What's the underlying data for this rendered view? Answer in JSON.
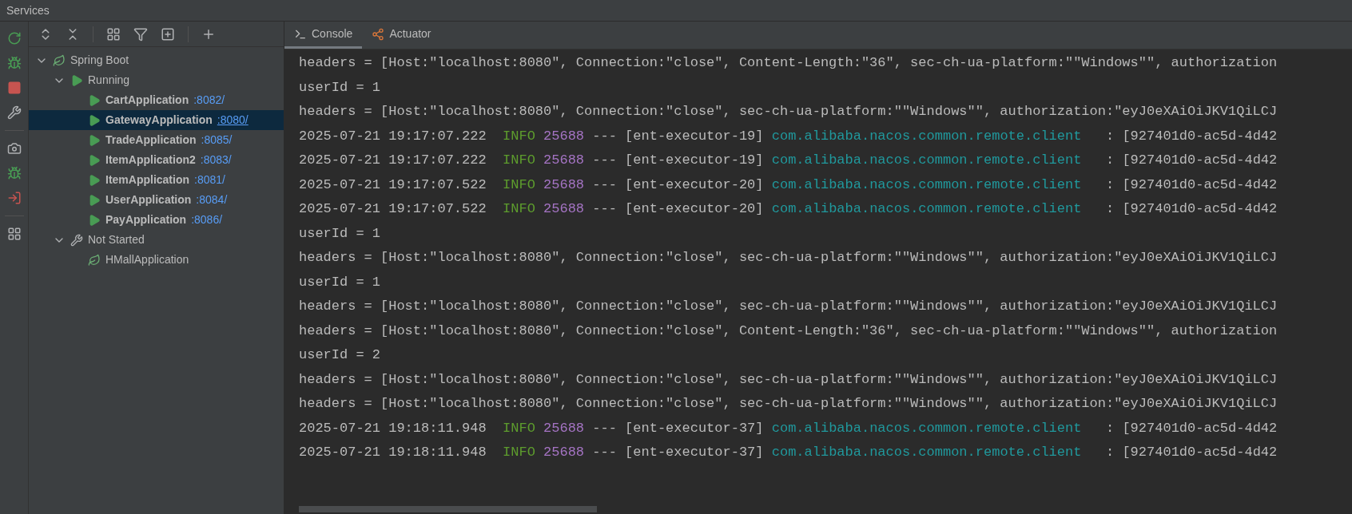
{
  "window": {
    "title": "Services"
  },
  "tree": [
    {
      "label": "Spring Boot",
      "kind": "spring",
      "expanded": true,
      "selected": false,
      "children": [
        {
          "label": "Running",
          "kind": "running",
          "expanded": true,
          "selected": false,
          "children": [
            {
              "label": "CartApplication",
              "port": ":8082/",
              "kind": "app-running",
              "selected": false
            },
            {
              "label": "GatewayApplication",
              "port": ":8080/",
              "kind": "app-running",
              "selected": true
            },
            {
              "label": "TradeApplication",
              "port": ":8085/",
              "kind": "app-running",
              "selected": false
            },
            {
              "label": "ItemApplication2",
              "port": ":8083/",
              "kind": "app-running",
              "selected": false
            },
            {
              "label": "ItemApplication",
              "port": ":8081/",
              "kind": "app-running",
              "selected": false
            },
            {
              "label": "UserApplication",
              "port": ":8084/",
              "kind": "app-running",
              "selected": false
            },
            {
              "label": "PayApplication",
              "port": ":8086/",
              "kind": "app-running",
              "selected": false
            }
          ]
        },
        {
          "label": "Not Started",
          "kind": "not-started",
          "expanded": true,
          "selected": false,
          "children": [
            {
              "label": "HMallApplication",
              "kind": "app-idle",
              "selected": false
            }
          ]
        }
      ]
    }
  ],
  "tabs": [
    {
      "label": "Console",
      "kind": "console",
      "selected": true
    },
    {
      "label": "Actuator",
      "kind": "actuator",
      "selected": false
    }
  ],
  "console": [
    {
      "kind": "plain",
      "text": "headers = [Host:\"localhost:8080\", Connection:\"close\", Content-Length:\"36\", sec-ch-ua-platform:\"\"Windows\"\", authorization"
    },
    {
      "kind": "plain",
      "text": "userId = 1"
    },
    {
      "kind": "plain",
      "text": "headers = [Host:\"localhost:8080\", Connection:\"close\", sec-ch-ua-platform:\"\"Windows\"\", authorization:\"eyJ0eXAiOiJKV1QiLCJ"
    },
    {
      "kind": "log",
      "timestamp": "2025-07-21 19:17:07.222",
      "level": "INFO",
      "pid": "25688",
      "thread": "--- [ent-executor-19]",
      "logger": "com.alibaba.nacos.common.remote.client",
      "message": ": [927401d0-ac5d-4d42"
    },
    {
      "kind": "log",
      "timestamp": "2025-07-21 19:17:07.222",
      "level": "INFO",
      "pid": "25688",
      "thread": "--- [ent-executor-19]",
      "logger": "com.alibaba.nacos.common.remote.client",
      "message": ": [927401d0-ac5d-4d42"
    },
    {
      "kind": "log",
      "timestamp": "2025-07-21 19:17:07.522",
      "level": "INFO",
      "pid": "25688",
      "thread": "--- [ent-executor-20]",
      "logger": "com.alibaba.nacos.common.remote.client",
      "message": ": [927401d0-ac5d-4d42"
    },
    {
      "kind": "log",
      "timestamp": "2025-07-21 19:17:07.522",
      "level": "INFO",
      "pid": "25688",
      "thread": "--- [ent-executor-20]",
      "logger": "com.alibaba.nacos.common.remote.client",
      "message": ": [927401d0-ac5d-4d42"
    },
    {
      "kind": "plain",
      "text": "userId = 1"
    },
    {
      "kind": "plain",
      "text": "headers = [Host:\"localhost:8080\", Connection:\"close\", sec-ch-ua-platform:\"\"Windows\"\", authorization:\"eyJ0eXAiOiJKV1QiLCJ"
    },
    {
      "kind": "plain",
      "text": "userId = 1"
    },
    {
      "kind": "plain",
      "text": "headers = [Host:\"localhost:8080\", Connection:\"close\", sec-ch-ua-platform:\"\"Windows\"\", authorization:\"eyJ0eXAiOiJKV1QiLCJ"
    },
    {
      "kind": "plain",
      "text": "headers = [Host:\"localhost:8080\", Connection:\"close\", Content-Length:\"36\", sec-ch-ua-platform:\"\"Windows\"\", authorization"
    },
    {
      "kind": "plain",
      "text": "userId = 2"
    },
    {
      "kind": "plain",
      "text": "headers = [Host:\"localhost:8080\", Connection:\"close\", sec-ch-ua-platform:\"\"Windows\"\", authorization:\"eyJ0eXAiOiJKV1QiLCJ"
    },
    {
      "kind": "plain",
      "text": "headers = [Host:\"localhost:8080\", Connection:\"close\", sec-ch-ua-platform:\"\"Windows\"\", authorization:\"eyJ0eXAiOiJKV1QiLCJ"
    },
    {
      "kind": "log",
      "timestamp": "2025-07-21 19:18:11.948",
      "level": "INFO",
      "pid": "25688",
      "thread": "--- [ent-executor-37]",
      "logger": "com.alibaba.nacos.common.remote.client",
      "message": ": [927401d0-ac5d-4d42"
    },
    {
      "kind": "log",
      "timestamp": "2025-07-21 19:18:11.948",
      "level": "INFO",
      "pid": "25688",
      "thread": "--- [ent-executor-37]",
      "logger": "com.alibaba.nacos.common.remote.client",
      "message": ": [927401d0-ac5d-4d42"
    }
  ]
}
